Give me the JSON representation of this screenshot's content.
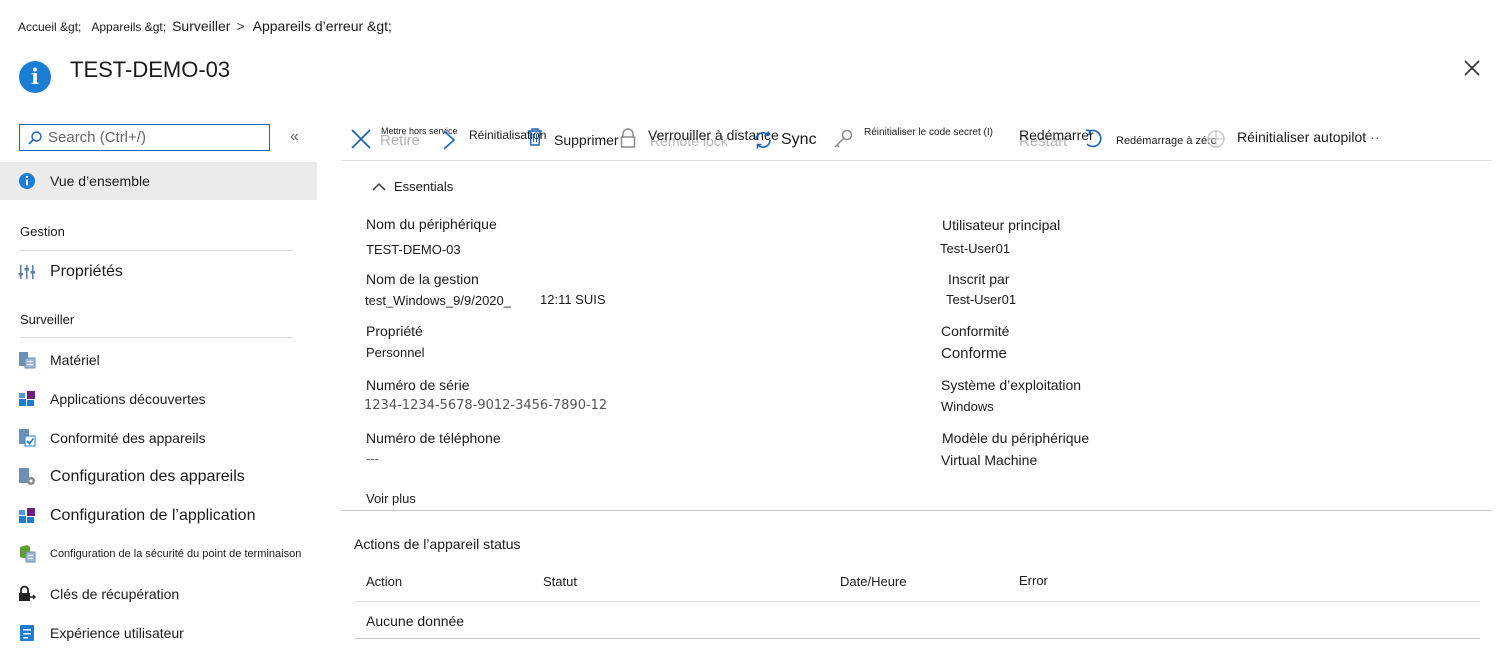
{
  "breadcrumb": {
    "home": "Accueil &gt;",
    "devices": "Appareils &gt;",
    "monitor": "Surveiller",
    "chevron": ">",
    "error_devices": "Appareils d’erreur &gt;"
  },
  "header": {
    "title": "TEST-DEMO-03"
  },
  "search": {
    "placeholder": "Search (Ctrl+/)"
  },
  "sidebar": {
    "collapse_glyph": "«",
    "overview": "Vue d’ensemble",
    "group_manage": "Gestion",
    "properties": "Propriétés",
    "group_monitor": "Surveiller",
    "items": [
      {
        "label": "Matériel"
      },
      {
        "label": "Applications découvertes"
      },
      {
        "label": "Conformité des appareils"
      },
      {
        "label": "Configuration des appareils"
      },
      {
        "label": "Configuration de l’application"
      },
      {
        "label": "Configuration de la sécurité du point de terminaison"
      },
      {
        "label": "Clés de récupération"
      },
      {
        "label": "Expérience utilisateur"
      }
    ]
  },
  "toolbar": {
    "retire_ghost": "Retire",
    "retire": "Mettre hors service",
    "reset": "Réinitialisation",
    "delete": "Supprimer",
    "lock_ghost": "Remote lock",
    "lock": "Verrouiller à distance",
    "sync": "Sync",
    "passcode": "Réinitialiser le code secret (I)",
    "restart_ghost": "Restart",
    "restart": "Redémarrer",
    "fresh_start": "Redémarrage à zéro",
    "autopilot": "Réinitialiser autopilot",
    "more": "··"
  },
  "essentials": {
    "title": "Essentials",
    "device_name_label": "Nom du périphérique",
    "device_name": "TEST-DEMO-03",
    "mgmt_name_label": "Nom de la gestion",
    "mgmt_name": "test_Windows_9/9/2020_",
    "mgmt_time": "12:11 SUIS",
    "ownership_label": "Propriété",
    "ownership": "Personnel",
    "serial_label": "Numéro de série",
    "serial": "1234-1234-5678-9012-3456-7890-12",
    "phone_label": "Numéro de téléphone",
    "phone": "---",
    "primary_user_label": "Utilisateur principal",
    "primary_user": "Test-User01",
    "enrolled_by_label": "Inscrit par",
    "enrolled_by": "Test-User01",
    "compliance_label": "Conformité",
    "compliance": "Conforme",
    "os_label": "Système d’exploitation",
    "os": "Windows",
    "model_label": "Modèle du périphérique",
    "model": "Virtual Machine",
    "see_more": "Voir plus"
  },
  "actions_status": {
    "title": "Actions de l’appareil status",
    "columns": [
      "Action",
      "Statut",
      "Date/Heure",
      "Error"
    ],
    "empty": "Aucune donnée"
  },
  "colors": {
    "accent": "#1a7fd4",
    "purple": "#68217a",
    "green": "#5ea02f"
  }
}
